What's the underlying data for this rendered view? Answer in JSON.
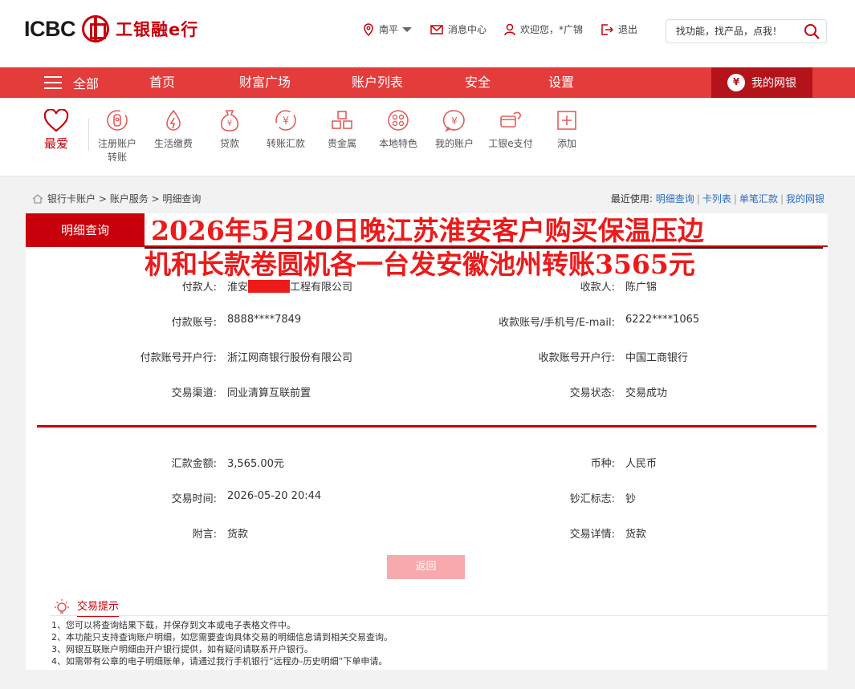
{
  "header": {
    "logo_en": "ICBC",
    "logo_cn": "工银融e行",
    "location": "南平",
    "messages": "消息中心",
    "welcome": "欢迎您，*广锦",
    "logout": "退出",
    "search_placeholder": "找功能，找产品，点我！"
  },
  "nav": {
    "all": "全部",
    "items": [
      "首页",
      "财富广场",
      "账户列表",
      "安全",
      "设置"
    ],
    "mybank": "我的网银"
  },
  "quick_menu": {
    "favorite": "最爱",
    "items": [
      {
        "label1": "注册账户",
        "label2": "转账",
        "icon": "account-transfer-icon"
      },
      {
        "label1": "生活缴费",
        "label2": "",
        "icon": "utility-payment-icon"
      },
      {
        "label1": "贷款",
        "label2": "",
        "icon": "loan-icon"
      },
      {
        "label1": "转账汇款",
        "label2": "",
        "icon": "transfer-icon"
      },
      {
        "label1": "贵金属",
        "label2": "",
        "icon": "precious-metal-icon"
      },
      {
        "label1": "本地特色",
        "label2": "",
        "icon": "local-feature-icon"
      },
      {
        "label1": "我的账户",
        "label2": "",
        "icon": "my-account-icon"
      },
      {
        "label1": "工银e支付",
        "label2": "",
        "icon": "e-pay-icon"
      },
      {
        "label1": "添加",
        "label2": "",
        "icon": "add-icon"
      }
    ]
  },
  "breadcrumb": {
    "items": [
      "银行卡账户",
      "账户服务",
      "明细查询"
    ]
  },
  "recent": {
    "label": "最近使用:",
    "links": [
      "明细查询",
      "卡列表",
      "单笔汇款",
      "我的网银"
    ]
  },
  "panel": {
    "tab": "明细查询"
  },
  "overlay": {
    "line1": "2026年5月20日晚江苏淮安客户购买保温压边",
    "line2": "机和长款卷圆机各一台发安徽池州转账3565元"
  },
  "details": {
    "payer_label": "付款人:",
    "payer_prefix": "淮安",
    "payer_suffix": "工程有限公司",
    "payee_label": "收款人:",
    "payee": "陈广锦",
    "payer_acct_label": "付款账号:",
    "payer_acct": "8888****7849",
    "payee_acct_label": "收款账号/手机号/E-mail:",
    "payee_acct": "6222****1065",
    "payer_bank_label": "付款账号开户行:",
    "payer_bank": "浙江网商银行股份有限公司",
    "payee_bank_label": "收款账号开户行:",
    "payee_bank": "中国工商银行",
    "channel_label": "交易渠道:",
    "channel": "同业清算互联前置",
    "status_label": "交易状态:",
    "status": "交易成功",
    "amount_label": "汇款金额:",
    "amount": "3,565.00元",
    "currency_label": "币种:",
    "currency": "人民币",
    "time_label": "交易时间:",
    "time": "2026-05-20 20:44",
    "cash_label": "钞汇标志:",
    "cash": "钞",
    "remark_label": "附言:",
    "remark": "货款",
    "detail_label": "交易详情:",
    "detail": "货款"
  },
  "back_button": "返回",
  "tips": {
    "title": "交易提示",
    "items": [
      "1、您可以将查询结果下载，并保存到文本或电子表格文件中。",
      "2、本功能只支持查询账户明细，如您需要查询具体交易的明细信息请到相关交易查询。",
      "3、网银互联账户明细由开户银行提供，如有疑问请联系开户银行。",
      "4、如需带有公章的电子明细账单，请通过我行手机银行“远程办-历史明细”下单申请。"
    ]
  },
  "colors": {
    "brand_red": "#c7000b",
    "nav_red": "#e43b3b",
    "mybank_red": "#b4131a",
    "overlay_red": "#ec1a1a",
    "link_blue": "#2a6bc4",
    "button_pink": "#f7a9ad"
  }
}
